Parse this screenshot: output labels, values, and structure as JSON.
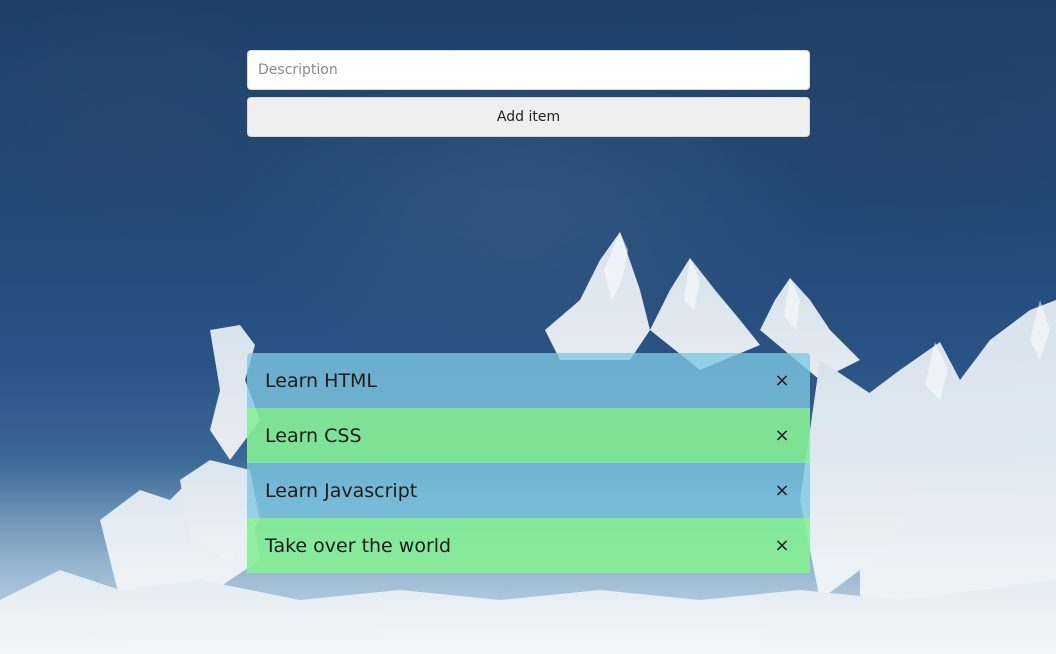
{
  "form": {
    "description_value": "",
    "description_placeholder": "Description",
    "add_label": "Add item"
  },
  "todos": [
    {
      "text": "Learn HTML",
      "color": "#7dc8e1",
      "remove_icon": "close-icon",
      "remove_glyph": "×"
    },
    {
      "text": "Learn CSS",
      "color": "#86f096",
      "remove_icon": "close-icon",
      "remove_glyph": "×"
    },
    {
      "text": "Learn Javascript",
      "color": "#7dc8e1",
      "remove_icon": "close-icon",
      "remove_glyph": "×"
    },
    {
      "text": "Take over the world",
      "color": "#86f096",
      "remove_icon": "close-icon",
      "remove_glyph": "×"
    }
  ],
  "colors": {
    "background_dark": "#1d3f66",
    "item_blue": "#7dc8e1",
    "item_green": "#86f096"
  }
}
